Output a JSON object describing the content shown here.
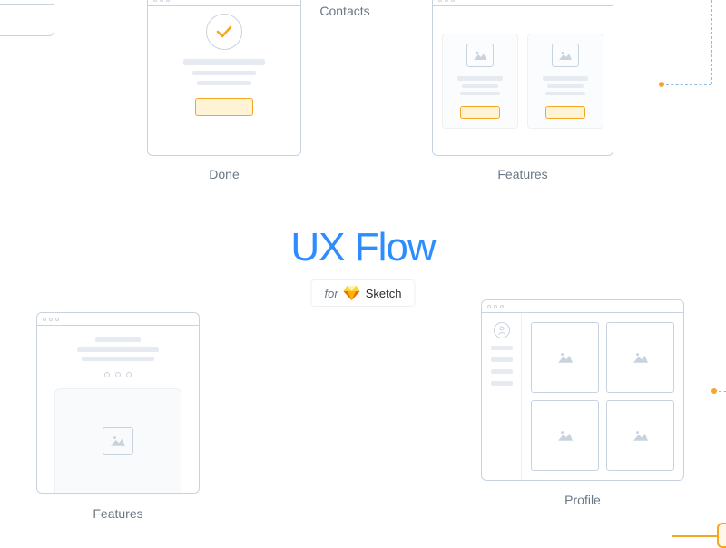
{
  "title": "UX Flow",
  "badge": {
    "for": "for",
    "app": "Sketch"
  },
  "labels": {
    "contacts": "Contacts",
    "done": "Done",
    "features1": "Features",
    "features2": "Features",
    "profile": "Profile"
  }
}
